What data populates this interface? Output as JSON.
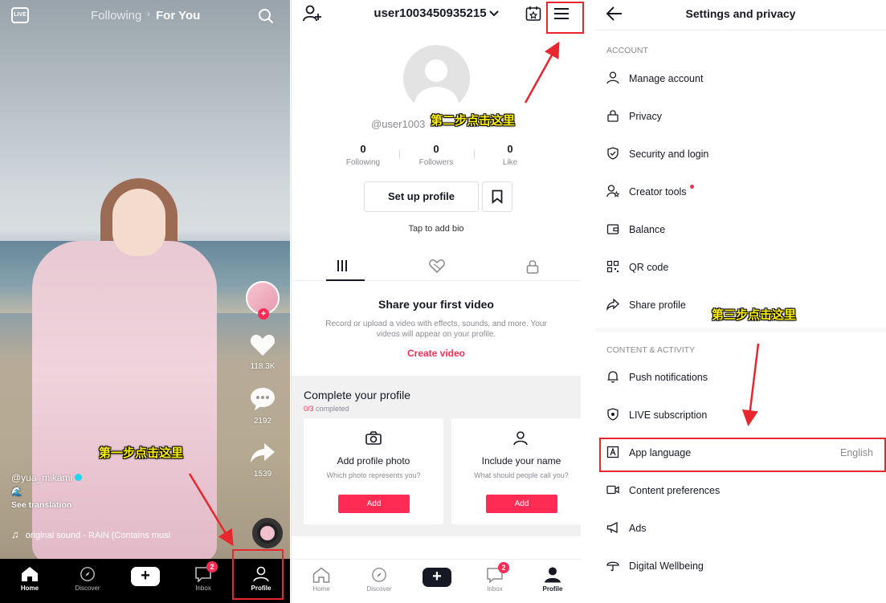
{
  "feed": {
    "tab_following": "Following",
    "tab_for_you": "For You",
    "likes": "118.3K",
    "comments": "2192",
    "shares": "1539",
    "username": "@yua_mikami",
    "caption_emoji": "🌊",
    "see_translation": "See translation",
    "sound": "original sound - RAiN (Contains musi",
    "live_label": "LIVE"
  },
  "nav": {
    "home": "Home",
    "discover": "Discover",
    "inbox": "Inbox",
    "inbox_badge": "2",
    "profile": "Profile",
    "create_symbol": "+"
  },
  "profile": {
    "username": "user1003450935215",
    "handle": "@user1003",
    "stats": [
      {
        "num": "0",
        "label": "Following"
      },
      {
        "num": "0",
        "label": "Followers"
      },
      {
        "num": "0",
        "label": "Like"
      }
    ],
    "setup_button": "Set up profile",
    "bio": "Tap to add bio",
    "share_title": "Share your first video",
    "share_desc": "Record or upload a video with effects, sounds, and more. Your videos will appear on your profile.",
    "create_video": "Create video",
    "complete_title": "Complete your profile",
    "complete_count": "0/3",
    "complete_suffix": " completed",
    "cards": [
      {
        "title": "Add profile photo",
        "desc": "Which photo represents you?",
        "button": "Add"
      },
      {
        "title": "Include your name",
        "desc": "What should people call you?",
        "button": "Add"
      }
    ]
  },
  "settings": {
    "title": "Settings and privacy",
    "section_account": "ACCOUNT",
    "section_content": "CONTENT & ACTIVITY",
    "items_account": [
      {
        "label": "Manage account",
        "icon": "person-icon"
      },
      {
        "label": "Privacy",
        "icon": "lock-icon"
      },
      {
        "label": "Security and login",
        "icon": "shield-icon"
      },
      {
        "label": "Creator tools",
        "icon": "creator-icon"
      },
      {
        "label": "Balance",
        "icon": "wallet-icon"
      },
      {
        "label": "QR code",
        "icon": "qr-icon"
      },
      {
        "label": "Share profile",
        "icon": "share-icon"
      }
    ],
    "items_content": [
      {
        "label": "Push notifications",
        "icon": "bell-icon"
      },
      {
        "label": "LIVE subscription",
        "icon": "live-sub-icon"
      },
      {
        "label": "App language",
        "value": "English",
        "icon": "language-icon"
      },
      {
        "label": "Content preferences",
        "icon": "video-icon"
      },
      {
        "label": "Ads",
        "icon": "megaphone-icon"
      },
      {
        "label": "Digital Wellbeing",
        "icon": "umbrella-icon"
      }
    ]
  },
  "annotations": {
    "step1": "第一步点击这里",
    "step2": "第二步点击这里",
    "step3": "第三步点击这里",
    "color": "#e8262d",
    "text_color": "#fff200"
  }
}
